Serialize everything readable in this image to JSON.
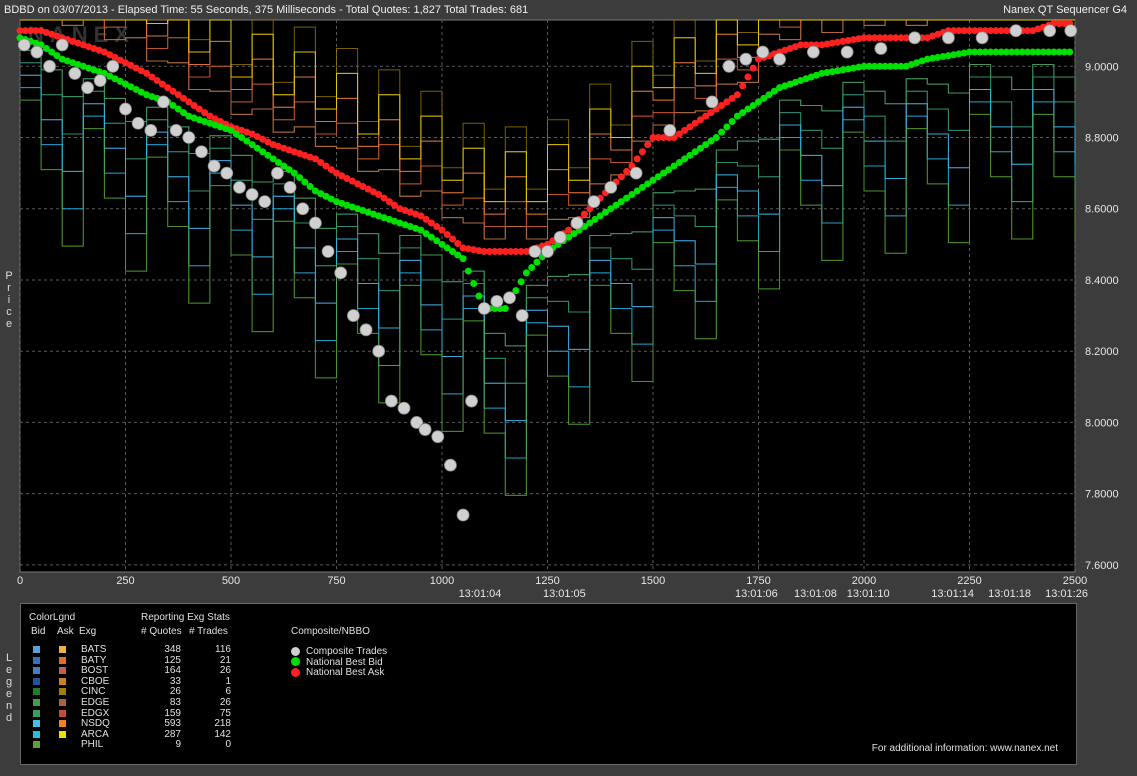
{
  "header": {
    "left": "BDBD on 03/07/2013  -  Elapsed Time: 55 Seconds, 375 Milliseconds  -  Total Quotes: 1,827  Total Trades: 681",
    "right": "Nanex QT Sequencer G4"
  },
  "watermark": "NANEX",
  "side_labels": {
    "price": "Price",
    "legend": "Legend"
  },
  "colors": {
    "background": "#000000",
    "grid": "#5a5a5a",
    "bid": "#00e000",
    "ask": "#ff2020",
    "trade": "#d0d0d0"
  },
  "chart_data": {
    "type": "line",
    "title": "",
    "ylabel": "Price",
    "xlabel": "",
    "xlim": [
      0,
      2500
    ],
    "ylim": [
      7.58,
      9.13
    ],
    "x_ticks": [
      "0",
      "250",
      "500",
      "750",
      "1000",
      "1250",
      "1500",
      "1750",
      "2000",
      "2250",
      "2500"
    ],
    "y_ticks": [
      "7.6000",
      "7.8000",
      "8.0000",
      "8.2000",
      "8.4000",
      "8.6000",
      "8.8000",
      "9.0000"
    ],
    "time_labels": [
      {
        "x": 1090,
        "label": "13:01:04"
      },
      {
        "x": 1290,
        "label": "13:01:05"
      },
      {
        "x": 1745,
        "label": "13:01:06"
      },
      {
        "x": 1885,
        "label": "13:01:08"
      },
      {
        "x": 2010,
        "label": "13:01:10"
      },
      {
        "x": 2210,
        "label": "13:01:14"
      },
      {
        "x": 2345,
        "label": "13:01:18"
      },
      {
        "x": 2480,
        "label": "13:01:26"
      }
    ],
    "series": [
      {
        "name": "National Best Bid",
        "x": [
          0,
          50,
          100,
          150,
          200,
          250,
          300,
          350,
          400,
          450,
          500,
          550,
          600,
          650,
          700,
          750,
          800,
          850,
          900,
          950,
          1000,
          1050,
          1100,
          1150,
          1200,
          1250,
          1300,
          1350,
          1400,
          1450,
          1500,
          1550,
          1600,
          1650,
          1700,
          1750,
          1800,
          1850,
          1900,
          1950,
          2000,
          2050,
          2100,
          2150,
          2200,
          2250,
          2300,
          2350,
          2400,
          2450,
          2500
        ],
        "y": [
          9.08,
          9.06,
          9.02,
          9.0,
          8.98,
          8.95,
          8.92,
          8.9,
          8.86,
          8.84,
          8.82,
          8.78,
          8.74,
          8.7,
          8.65,
          8.62,
          8.6,
          8.58,
          8.56,
          8.54,
          8.5,
          8.46,
          8.32,
          8.32,
          8.42,
          8.48,
          8.52,
          8.56,
          8.6,
          8.64,
          8.68,
          8.72,
          8.76,
          8.8,
          8.86,
          8.9,
          8.94,
          8.96,
          8.98,
          8.99,
          9.0,
          9.0,
          9.0,
          9.02,
          9.03,
          9.04,
          9.04,
          9.04,
          9.04,
          9.04,
          9.04
        ]
      },
      {
        "name": "National Best Ask",
        "x": [
          0,
          50,
          100,
          150,
          200,
          250,
          300,
          350,
          400,
          450,
          500,
          550,
          600,
          650,
          700,
          750,
          800,
          850,
          900,
          950,
          1000,
          1050,
          1100,
          1150,
          1200,
          1250,
          1300,
          1350,
          1400,
          1450,
          1500,
          1550,
          1600,
          1650,
          1700,
          1750,
          1800,
          1850,
          1900,
          1950,
          2000,
          2050,
          2100,
          2150,
          2200,
          2250,
          2300,
          2350,
          2400,
          2450,
          2500
        ],
        "y": [
          9.1,
          9.1,
          9.08,
          9.06,
          9.04,
          9.01,
          8.98,
          8.94,
          8.9,
          8.86,
          8.83,
          8.81,
          8.78,
          8.76,
          8.74,
          8.7,
          8.67,
          8.64,
          8.6,
          8.58,
          8.54,
          8.49,
          8.48,
          8.48,
          8.48,
          8.5,
          8.54,
          8.6,
          8.66,
          8.72,
          8.8,
          8.8,
          8.84,
          8.88,
          8.92,
          9.02,
          9.04,
          9.06,
          9.06,
          9.07,
          9.08,
          9.08,
          9.08,
          9.08,
          9.1,
          9.1,
          9.1,
          9.1,
          9.1,
          9.12,
          9.12
        ]
      },
      {
        "name": "Composite Trades",
        "x": [
          10,
          40,
          70,
          100,
          130,
          160,
          190,
          220,
          250,
          280,
          310,
          340,
          370,
          400,
          430,
          460,
          490,
          520,
          550,
          580,
          610,
          640,
          670,
          700,
          730,
          760,
          790,
          820,
          850,
          880,
          910,
          940,
          960,
          990,
          1020,
          1050,
          1070,
          1100,
          1130,
          1160,
          1190,
          1220,
          1250,
          1280,
          1320,
          1360,
          1400,
          1460,
          1540,
          1640,
          1680,
          1720,
          1760,
          1800,
          1880,
          1960,
          2040,
          2120,
          2200,
          2280,
          2360,
          2440,
          2490
        ],
        "y": [
          9.06,
          9.04,
          9.0,
          9.06,
          8.98,
          8.94,
          8.96,
          9.0,
          8.88,
          8.84,
          8.82,
          8.9,
          8.82,
          8.8,
          8.76,
          8.72,
          8.7,
          8.66,
          8.64,
          8.62,
          8.7,
          8.66,
          8.6,
          8.56,
          8.48,
          8.42,
          8.3,
          8.26,
          8.2,
          8.06,
          8.04,
          8.0,
          7.98,
          7.96,
          7.88,
          7.74,
          8.06,
          8.32,
          8.34,
          8.35,
          8.3,
          8.48,
          8.48,
          8.52,
          8.56,
          8.62,
          8.66,
          8.7,
          8.82,
          8.9,
          9.0,
          9.02,
          9.04,
          9.02,
          9.04,
          9.04,
          9.05,
          9.08,
          9.08,
          9.08,
          9.1,
          9.1,
          9.1
        ]
      }
    ]
  },
  "legend": {
    "color_legend_title": "ColorLgnd",
    "stats_title": "Reporting Exg Stats",
    "col_bid": "Bid",
    "col_ask": "Ask",
    "col_exg": "Exg",
    "col_quotes": "# Quotes",
    "col_trades": "# Trades",
    "composite_title": "Composite/NBBO",
    "composite_items": [
      {
        "label": "Composite Trades",
        "color": "#d0d0d0"
      },
      {
        "label": "National Best Bid",
        "color": "#00e000"
      },
      {
        "label": "National Best Ask",
        "color": "#ff2020"
      }
    ],
    "exchanges": [
      {
        "exg": "BATS",
        "quotes": "348",
        "trades": "116",
        "bid_color": "#5aa0e0",
        "ask_color": "#f0b040"
      },
      {
        "exg": "BATY",
        "quotes": "125",
        "trades": "21",
        "bid_color": "#3070c0",
        "ask_color": "#e07020"
      },
      {
        "exg": "BOST",
        "quotes": "164",
        "trades": "26",
        "bid_color": "#4080c0",
        "ask_color": "#c06050"
      },
      {
        "exg": "CBOE",
        "quotes": "33",
        "trades": "1",
        "bid_color": "#2050a0",
        "ask_color": "#d08020"
      },
      {
        "exg": "CINC",
        "quotes": "26",
        "trades": "6",
        "bid_color": "#208020",
        "ask_color": "#a08000"
      },
      {
        "exg": "EDGE",
        "quotes": "83",
        "trades": "26",
        "bid_color": "#40a040",
        "ask_color": "#b06040"
      },
      {
        "exg": "EDGX",
        "quotes": "159",
        "trades": "75",
        "bid_color": "#30a060",
        "ask_color": "#c05030"
      },
      {
        "exg": "NSDQ",
        "quotes": "593",
        "trades": "218",
        "bid_color": "#40c0f0",
        "ask_color": "#f08030"
      },
      {
        "exg": "ARCA",
        "quotes": "287",
        "trades": "142",
        "bid_color": "#20c0e0",
        "ask_color": "#f0e000"
      },
      {
        "exg": "PHIL",
        "quotes": "9",
        "trades": "0",
        "bid_color": "#60a030",
        "ask_color": ""
      }
    ],
    "footer": "For additional information: www.nanex.net"
  }
}
